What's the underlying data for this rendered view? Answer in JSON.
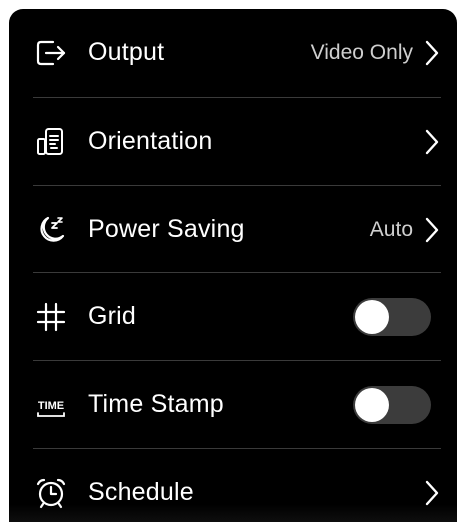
{
  "settings": {
    "items": [
      {
        "id": "output",
        "icon": "output-icon",
        "label": "Output",
        "value": "Video Only",
        "control": "chevron"
      },
      {
        "id": "orientation",
        "icon": "orientation-icon",
        "label": "Orientation",
        "value": "",
        "control": "chevron"
      },
      {
        "id": "power-saving",
        "icon": "power-saving-icon",
        "label": "Power Saving",
        "value": "Auto",
        "control": "chevron"
      },
      {
        "id": "grid",
        "icon": "grid-icon",
        "label": "Grid",
        "control": "toggle",
        "enabled": false
      },
      {
        "id": "time-stamp",
        "icon": "time-stamp-icon",
        "label": "Time Stamp",
        "control": "toggle",
        "enabled": false
      },
      {
        "id": "schedule",
        "icon": "alarm-clock-icon",
        "label": "Schedule",
        "value": "",
        "control": "chevron"
      }
    ]
  },
  "colors": {
    "background": "#000000",
    "text": "#ffffff",
    "value_text": "#cfcfcf",
    "divider": "#3a3a3a",
    "toggle_off_track": "#3c3c3c",
    "toggle_knob": "#ffffff"
  }
}
